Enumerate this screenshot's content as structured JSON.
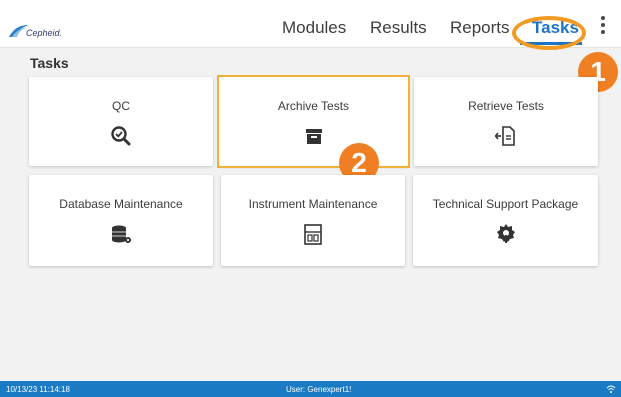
{
  "header": {
    "logo_text": "Cepheid.",
    "nav": [
      {
        "label": "Modules"
      },
      {
        "label": "Results"
      },
      {
        "label": "Reports"
      },
      {
        "label": "Tasks",
        "active": true
      }
    ]
  },
  "annotations": {
    "step1": "1",
    "step2": "2"
  },
  "page": {
    "title": "Tasks"
  },
  "tiles": [
    {
      "label": "QC",
      "icon": "qc-magnifier-icon"
    },
    {
      "label": "Archive Tests",
      "icon": "archive-box-icon"
    },
    {
      "label": "Retrieve Tests",
      "icon": "retrieve-document-icon"
    },
    {
      "label": "Database Maintenance",
      "icon": "database-gear-icon"
    },
    {
      "label": "Instrument Maintenance",
      "icon": "instrument-icon"
    },
    {
      "label": "Technical Support Package",
      "icon": "support-gear-icon"
    }
  ],
  "status": {
    "datetime": "10/13/23 11:14:18",
    "user": "User: Genexpert1!"
  },
  "colors": {
    "accent": "#1f73c4",
    "status_bar": "#1a7ac4",
    "highlight": "#f29a21",
    "badge": "#f07e22"
  }
}
